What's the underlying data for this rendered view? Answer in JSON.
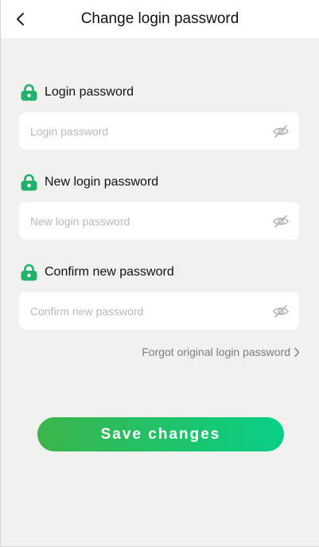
{
  "header": {
    "title": "Change login password",
    "back_icon": "chevron-left-icon"
  },
  "fields": [
    {
      "label": "Login password",
      "placeholder": "Login password",
      "value": "",
      "lock_icon": "lock-icon",
      "eye_icon": "eye-off-icon"
    },
    {
      "label": "New login password",
      "placeholder": "New login password",
      "value": "",
      "lock_icon": "lock-icon",
      "eye_icon": "eye-off-icon"
    },
    {
      "label": "Confirm new password",
      "placeholder": "Confirm new password",
      "value": "",
      "lock_icon": "lock-icon",
      "eye_icon": "eye-off-icon"
    }
  ],
  "forgot_link": {
    "label": "Forgot original login password"
  },
  "save_button": {
    "label": "Save changes"
  },
  "colors": {
    "accent_start": "#3bb54a",
    "accent_end": "#07cf86",
    "lock_green": "#20b26b",
    "background": "#f1f1ef"
  }
}
